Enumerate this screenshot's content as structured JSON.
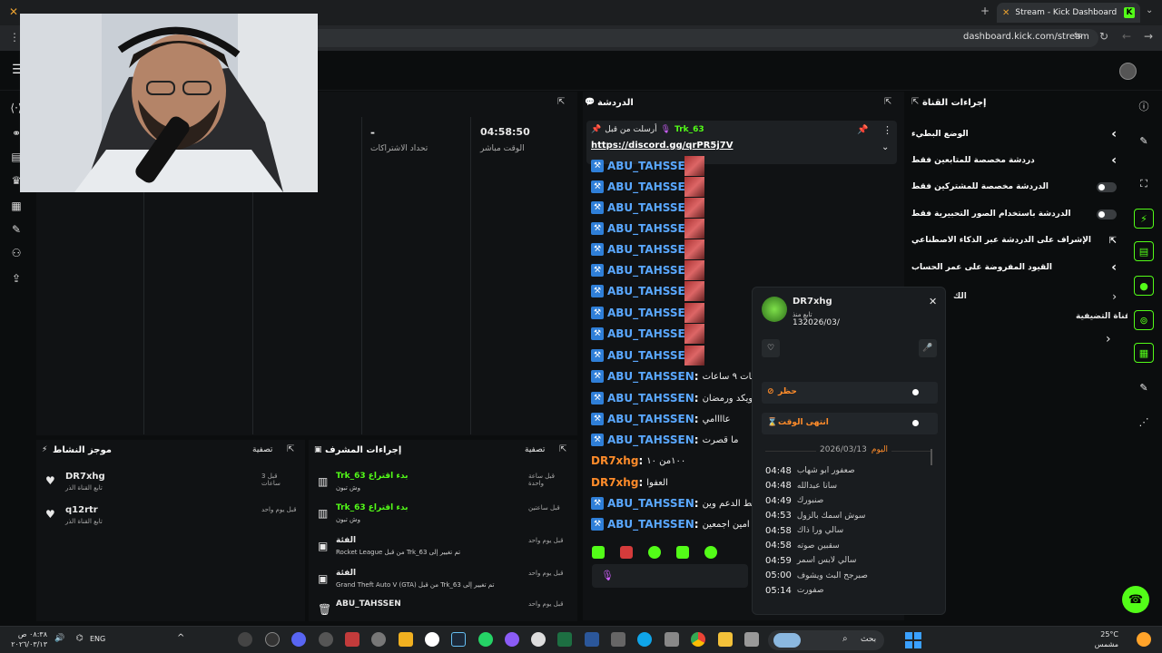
{
  "browser": {
    "tab_title": "Stream - Kick Dashboard",
    "url": "dashboard.kick.com/stream"
  },
  "stats": {
    "dash": "-",
    "subs_label": "تحداد الاشتراكات",
    "live_time": "04:58:50",
    "live_label": "الوقت مباشر"
  },
  "chat": {
    "title": "الدردشة",
    "pinned_by_label": "أرسلت من قبل",
    "pinned_user": "Trk_63",
    "pinned_link": "https://discord.gg/qrPR5j7V",
    "lines": [
      {
        "user": "ABU_TAHSSEN",
        "text": ""
      },
      {
        "user": "ABU_TAHSSEN",
        "text": ""
      },
      {
        "user": "ABU_TAHSSEN",
        "text": ""
      },
      {
        "user": "ABU_TAHSSEN",
        "text": ""
      },
      {
        "user": "ABU_TAHSSEN",
        "text": ""
      },
      {
        "user": "ABU_TAHSSEN",
        "text": ""
      },
      {
        "user": "ABU_TAHSSEN",
        "text": ""
      },
      {
        "user": "ABU_TAHSSEN",
        "text": ""
      },
      {
        "user": "ABU_TAHSSEN",
        "text": ""
      },
      {
        "user": "ABU_TAHSSEN",
        "text": ""
      },
      {
        "user": "ABU_TAHSSEN",
        "text": "ت بات ۹ ساعات"
      },
      {
        "user": "ABU_TAHSSEN",
        "text": "ويكد ورمضان"
      },
      {
        "user": "ABU_TAHSSEN",
        "text": "عاااامي"
      },
      {
        "user": "ABU_TAHSSEN",
        "text": "ما قصرت"
      },
      {
        "user": "DR7xhg",
        "text": "۱۰۰من ۱۰"
      },
      {
        "user": "DR7xhg",
        "text": "العفوا"
      },
      {
        "user": "ABU_TAHSSEN",
        "text": "روابط الدعم وين"
      },
      {
        "user": "ABU_TAHSSEN",
        "text": "امين اجمعين"
      }
    ]
  },
  "settings": {
    "title": "إجراءات القناة",
    "rows": [
      {
        "label": "الوضع البطيء",
        "control": "chevron"
      },
      {
        "label": "دردشة مخصصة للمتابعين فقط",
        "control": "chevron"
      },
      {
        "label": "الدردشة مخصصة للمشتركين فقط",
        "control": "toggle"
      },
      {
        "label": "الدردشة باستخدام الصور التحبيرية فقط",
        "control": "toggle"
      },
      {
        "label": "الإشراف على الدردشة عبر الذكاء الاصطناعي",
        "control": "external"
      },
      {
        "label": "القيود المفروضة على عمر الحساب",
        "control": "chevron"
      }
    ],
    "partial_label": "الك",
    "featured_label": "القناة التضيفية"
  },
  "popup": {
    "username": "DR7xhg",
    "follow_label": "تابع منذ",
    "follow_date": "132026/03/",
    "ban_label": "حظر",
    "timeout_label": "انتهى الوقت",
    "date_header": "2026/03/13",
    "today_label": "اليوم",
    "history": [
      {
        "time": "04:48",
        "msg": "صعفور ابو شهاب"
      },
      {
        "time": "04:48",
        "msg": "سانا عبدالله"
      },
      {
        "time": "04:49",
        "msg": "صنبورك"
      },
      {
        "time": "04:53",
        "msg": "سوش اسمك بالزول"
      },
      {
        "time": "04:58",
        "msg": "سالي ورا ذاك"
      },
      {
        "time": "04:58",
        "msg": "سقبين صوته"
      },
      {
        "time": "04:59",
        "msg": "سالي لابس اسمر"
      },
      {
        "time": "05:00",
        "msg": "صبرجح البث ويشوف"
      },
      {
        "time": "05:14",
        "msg": "صفورت"
      }
    ]
  },
  "activity": {
    "title": "موجز النشاط",
    "filter_label": "تصفية",
    "items": [
      {
        "user": "DR7xhg",
        "sub": "تابع القناة الذر",
        "ago": "قبل 3 ساعات"
      },
      {
        "user": "q12rtr",
        "sub": "تابع القناة الذر",
        "ago": "قبل يوم واحد"
      }
    ]
  },
  "modactions": {
    "title": "إجراءات المشرف",
    "filter_label": "تصفية",
    "items": [
      {
        "line1": "Trk_63 بدء اقتراع",
        "line2": "وش تبون",
        "ago": "قبل ساعة واحدة"
      },
      {
        "line1": "Trk_63 بدء اقتراع",
        "line2": "وش تبون",
        "ago": "قبل ساعتين"
      },
      {
        "line1": "الفئة",
        "line2": "Rocket League من قبل Trk_63 تم تغيير إلى",
        "ago": "قبل يوم واحد"
      },
      {
        "line1": "الفئة",
        "line2": "Grand Theft Auto V (GTA) من قبل Trk_63 تم تغيير إلى",
        "ago": "قبل يوم واحد"
      },
      {
        "line1": "ABU_TAHSSEN",
        "line2": "",
        "ago": "قبل يوم واحد"
      }
    ]
  },
  "taskbar": {
    "lang": "ENG",
    "time": "٠٨:٣٨ ص",
    "date": "٢٠٢٦/٠٣/١٣",
    "search_placeholder": "بحث",
    "weather_temp": "25°C",
    "weather_desc": "مشمس"
  }
}
